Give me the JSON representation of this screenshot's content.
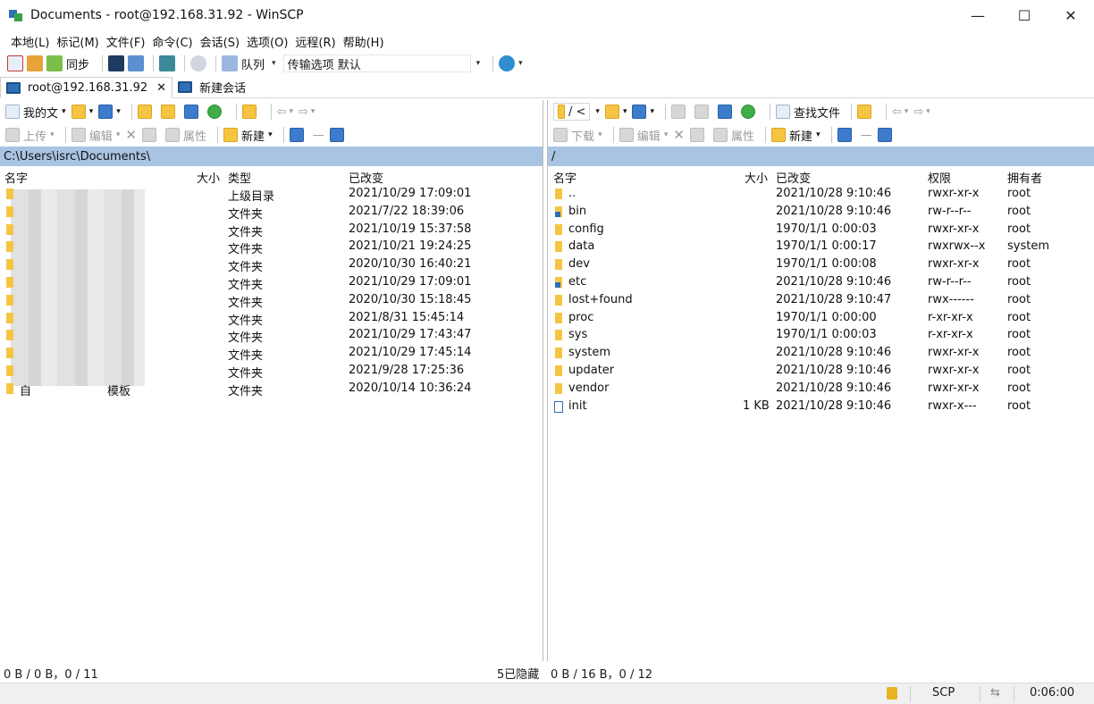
{
  "window": {
    "title": "Documents - root@192.168.31.92 - WinSCP",
    "controls": {
      "minimize": "—",
      "maximize": "☐",
      "close": "✕"
    }
  },
  "menu": [
    "本地(L)",
    "标记(M)",
    "文件(F)",
    "命令(C)",
    "会话(S)",
    "选项(O)",
    "远程(R)",
    "帮助(H)"
  ],
  "toolbar": {
    "sync_label": "同步",
    "queue_label": "队列",
    "transfer_label": "传输选项",
    "transfer_value": "默认"
  },
  "tabs": {
    "session": "root@192.168.31.92",
    "close": "✕",
    "new_session": "新建会话"
  },
  "left_pane": {
    "location": "我的文",
    "upload_label": "上传",
    "edit_label": "编辑",
    "properties_label": "属性",
    "new_label": "新建",
    "path": "C:\\Users\\isrc\\Documents\\",
    "columns": {
      "name": "名字",
      "size": "大小",
      "type": "类型",
      "modified": "已改变"
    },
    "rows": [
      {
        "name": "",
        "type": "上级目录",
        "modified": "2021/10/29  17:09:01"
      },
      {
        "name": "",
        "type": "文件夹",
        "modified": "2021/7/22  18:39:06"
      },
      {
        "name": "",
        "type": "文件夹",
        "modified": "2021/10/19  15:37:58"
      },
      {
        "name": "",
        "type": "文件夹",
        "modified": "2021/10/21  19:24:25"
      },
      {
        "name": "",
        "type": "文件夹",
        "modified": "2020/10/30  16:40:21"
      },
      {
        "name": "",
        "type": "文件夹",
        "modified": "2021/10/29  17:09:01"
      },
      {
        "name": "",
        "type": "文件夹",
        "modified": "2020/10/30  15:18:45"
      },
      {
        "name": "",
        "type": "文件夹",
        "modified": "2021/8/31  15:45:14"
      },
      {
        "name": "",
        "type": "文件夹",
        "modified": "2021/10/29  17:43:47"
      },
      {
        "name": "",
        "type": "文件夹",
        "modified": "2021/10/29  17:45:14"
      },
      {
        "name": "",
        "type": "文件夹",
        "modified": "2021/9/28  17:25:36"
      },
      {
        "name": "自",
        "name_suffix": "模板",
        "type": "文件夹",
        "modified": "2020/10/14  10:36:24"
      }
    ],
    "status_left": "0 B / 0 B，0 / 11",
    "status_right": "5已隐藏"
  },
  "right_pane": {
    "location": "/ <",
    "download_label": "下载",
    "edit_label": "编辑",
    "properties_label": "属性",
    "new_label": "新建",
    "find_label": "查找文件",
    "path": "/",
    "columns": {
      "name": "名字",
      "size": "大小",
      "modified": "已改变",
      "rights": "权限",
      "owner": "拥有者"
    },
    "rows": [
      {
        "name": "..",
        "size": "",
        "modified": "2021/10/28 9:10:46",
        "rights": "rwxr-xr-x",
        "owner": "root",
        "kind": "up"
      },
      {
        "name": "bin",
        "size": "",
        "modified": "2021/10/28 9:10:46",
        "rights": "rw-r--r--",
        "owner": "root",
        "kind": "link"
      },
      {
        "name": "config",
        "size": "",
        "modified": "1970/1/1 0:00:03",
        "rights": "rwxr-xr-x",
        "owner": "root",
        "kind": "folder"
      },
      {
        "name": "data",
        "size": "",
        "modified": "1970/1/1 0:00:17",
        "rights": "rwxrwx--x",
        "owner": "system",
        "kind": "folder"
      },
      {
        "name": "dev",
        "size": "",
        "modified": "1970/1/1 0:00:08",
        "rights": "rwxr-xr-x",
        "owner": "root",
        "kind": "folder"
      },
      {
        "name": "etc",
        "size": "",
        "modified": "2021/10/28 9:10:46",
        "rights": "rw-r--r--",
        "owner": "root",
        "kind": "link"
      },
      {
        "name": "lost+found",
        "size": "",
        "modified": "2021/10/28 9:10:47",
        "rights": "rwx------",
        "owner": "root",
        "kind": "folder"
      },
      {
        "name": "proc",
        "size": "",
        "modified": "1970/1/1 0:00:00",
        "rights": "r-xr-xr-x",
        "owner": "root",
        "kind": "folder"
      },
      {
        "name": "sys",
        "size": "",
        "modified": "1970/1/1 0:00:03",
        "rights": "r-xr-xr-x",
        "owner": "root",
        "kind": "folder"
      },
      {
        "name": "system",
        "size": "",
        "modified": "2021/10/28 9:10:46",
        "rights": "rwxr-xr-x",
        "owner": "root",
        "kind": "folder"
      },
      {
        "name": "updater",
        "size": "",
        "modified": "2021/10/28 9:10:46",
        "rights": "rwxr-xr-x",
        "owner": "root",
        "kind": "folder"
      },
      {
        "name": "vendor",
        "size": "",
        "modified": "2021/10/28 9:10:46",
        "rights": "rwxr-xr-x",
        "owner": "root",
        "kind": "folder"
      },
      {
        "name": "init",
        "size": "1 KB",
        "modified": "2021/10/28 9:10:46",
        "rights": "rwxr-x---",
        "owner": "root",
        "kind": "file"
      }
    ],
    "status": "0 B / 16 B，0 / 12"
  },
  "statusbar": {
    "protocol": "SCP",
    "elapsed": "0:06:00"
  },
  "colors": {
    "path_bar": "#a8c4e2",
    "folder": "#f5c542",
    "accent": "#2f6fb5"
  }
}
